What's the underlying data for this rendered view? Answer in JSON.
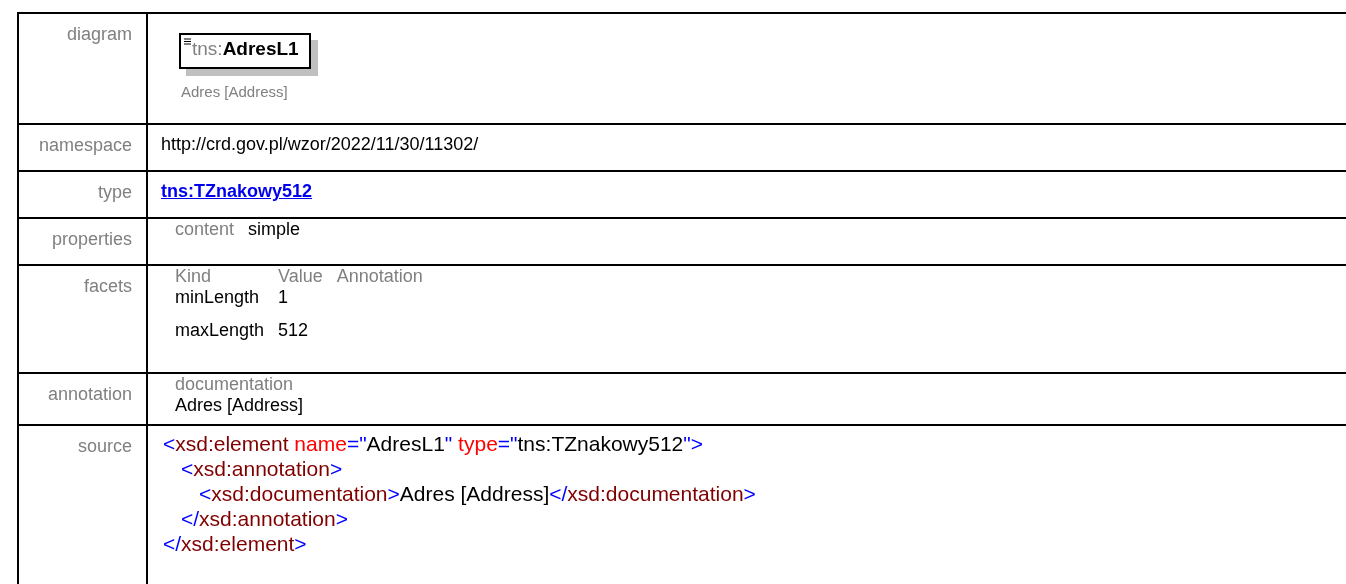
{
  "rows": [
    {
      "kind": "diagram",
      "label": "diagram",
      "element": {
        "prefix": "tns:",
        "name": "AdresL1"
      },
      "caption": "Adres [Address]"
    },
    {
      "kind": "text",
      "label": "namespace",
      "value": "http://crd.gov.pl/wzor/2022/11/30/11302/"
    },
    {
      "kind": "link",
      "label": "type",
      "value": "tns:TZnakowy512"
    },
    {
      "kind": "properties",
      "label": "properties",
      "items": [
        {
          "name": "content",
          "value": "simple"
        }
      ]
    },
    {
      "kind": "facets",
      "label": "facets",
      "columns": [
        "Kind",
        "Value",
        "Annotation"
      ],
      "items": [
        {
          "kind": "minLength",
          "value": "1"
        },
        {
          "kind": "maxLength",
          "value": "512"
        }
      ]
    },
    {
      "kind": "annotation",
      "label": "annotation",
      "heading": "documentation",
      "text": "Adres [Address]"
    },
    {
      "kind": "source",
      "label": "source",
      "code": {
        "open": [
          {
            "kind": "bracket",
            "text": "<"
          },
          {
            "kind": "tag",
            "text": "xsd:element"
          },
          {
            "kind": "attr",
            "text": " name"
          },
          {
            "kind": "bracket",
            "text": "=\""
          },
          {
            "kind": "plain",
            "text": "AdresL1"
          },
          {
            "kind": "bracket",
            "text": "\""
          },
          {
            "kind": "attr",
            "text": " type"
          },
          {
            "kind": "bracket",
            "text": "=\""
          },
          {
            "kind": "plain",
            "text": "tns:TZnakowy512"
          },
          {
            "kind": "bracket",
            "text": "\">"
          }
        ],
        "children": [
          {
            "open": [
              {
                "kind": "bracket",
                "text": "<"
              },
              {
                "kind": "tag",
                "text": "xsd:annotation"
              },
              {
                "kind": "bracket",
                "text": ">"
              }
            ],
            "children": [
              {
                "open": [
                  {
                    "kind": "bracket",
                    "text": "<"
                  },
                  {
                    "kind": "tag",
                    "text": "xsd:documentation"
                  },
                  {
                    "kind": "bracket",
                    "text": ">"
                  },
                  {
                    "kind": "plain",
                    "text": "Adres [Address]"
                  },
                  {
                    "kind": "bracket",
                    "text": "</"
                  },
                  {
                    "kind": "tag",
                    "text": "xsd:documentation"
                  },
                  {
                    "kind": "bracket",
                    "text": ">"
                  }
                ]
              }
            ],
            "close": [
              {
                "kind": "bracket",
                "text": "</"
              },
              {
                "kind": "tag",
                "text": "xsd:annotation"
              },
              {
                "kind": "bracket",
                "text": ">"
              }
            ]
          }
        ],
        "close": [
          {
            "kind": "bracket",
            "text": "</"
          },
          {
            "kind": "tag",
            "text": "xsd:element"
          },
          {
            "kind": "bracket",
            "text": ">"
          }
        ]
      }
    }
  ]
}
